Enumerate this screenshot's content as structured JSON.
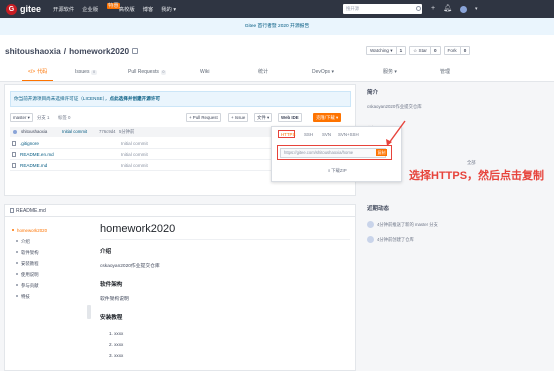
{
  "topnav": {
    "logo_text": "gitee",
    "links": [
      "开源软件",
      "企业版",
      "高校版",
      "博客",
      "我的 ▾"
    ],
    "enterprise_badge": "特惠",
    "search_placeholder": "搜开源",
    "icons": [
      "plus-icon",
      "bell-icon",
      "avatar"
    ]
  },
  "banner": {
    "text": "Gitee 首行者暨 2020 开源报告"
  },
  "repo": {
    "owner": "shitoushaoxia",
    "separator": " / ",
    "name": "homework2020",
    "watching_label": "Watching ▾",
    "watching_count": "1",
    "star_label": "☆ Star",
    "star_count": "0",
    "fork_label": "Fork",
    "fork_count": "0"
  },
  "tabs": [
    {
      "label": "代码",
      "num": ""
    },
    {
      "label": "Issues",
      "num": "0"
    },
    {
      "label": "Pull Requests",
      "num": "0"
    },
    {
      "label": "Wiki",
      "num": ""
    },
    {
      "label": "统计",
      "num": ""
    },
    {
      "label": "DevOps ▾",
      "num": ""
    },
    {
      "label": "服务 ▾",
      "num": ""
    },
    {
      "label": "管理",
      "num": ""
    }
  ],
  "license_notice": {
    "text": "你当前开源项目尚未选择许可证（LICENSE），",
    "link": "点此选择并创建开源许可"
  },
  "toolbar": {
    "branch": "master ▾",
    "branches": "分支 1",
    "tags": "标签 0",
    "pull_request": "+ Pull Request",
    "issue": "+ Issue",
    "file": "文件 ▾",
    "webide": "Web IDE",
    "clone": "克隆/下载 ▾"
  },
  "commit": {
    "author": "shitoushaoxia",
    "message": "Initial commit",
    "hash": "776c9d4",
    "time": "5分钟前"
  },
  "files": [
    {
      "name": ".gitignore",
      "commit": "Initial commit",
      "time": "5分钟前"
    },
    {
      "name": "README.en.md",
      "commit": "Initial commit",
      "time": "5分钟前"
    },
    {
      "name": "README.md",
      "commit": "Initial commit",
      "time": "5分钟前"
    }
  ],
  "clone": {
    "tabs": [
      "HTTPS",
      "SSH",
      "SVN",
      "SVN+SSH"
    ],
    "url": "https://gitee.com/shitoushaoxia/home",
    "copy": "复制",
    "download": "下载ZIP"
  },
  "sidebar": {
    "intro_title": "简介",
    "intro_desc": "cskaoyan2020作业提交仓库",
    "release_label": "发行",
    "release_text": "创建",
    "all_label": "全部",
    "activity_title": "近期动态",
    "activities": [
      "4分钟前推送了新的 master 分支",
      "4分钟前创建了仓库"
    ]
  },
  "annotation": {
    "text": "选择HTTPS，然后点击复制"
  },
  "readme": {
    "header": "README.md",
    "toc_top": "homework2020",
    "toc": [
      "介绍",
      "软件架构",
      "安装教程",
      "使用说明",
      "参与贡献",
      "特技"
    ],
    "title": "homework2020",
    "intro_h": "介绍",
    "intro_p": "cskaoyan2020作业提交仓库",
    "arch_h": "软件架构",
    "arch_p": "软件架构说明",
    "install_h": "安装教程",
    "install_items": [
      "1.  xxxx",
      "2.  xxxx",
      "3.  xxxx"
    ]
  },
  "colors": {
    "accent": "#fe7300",
    "nav_bg": "#2f3542",
    "annotation": "#e7433b"
  }
}
